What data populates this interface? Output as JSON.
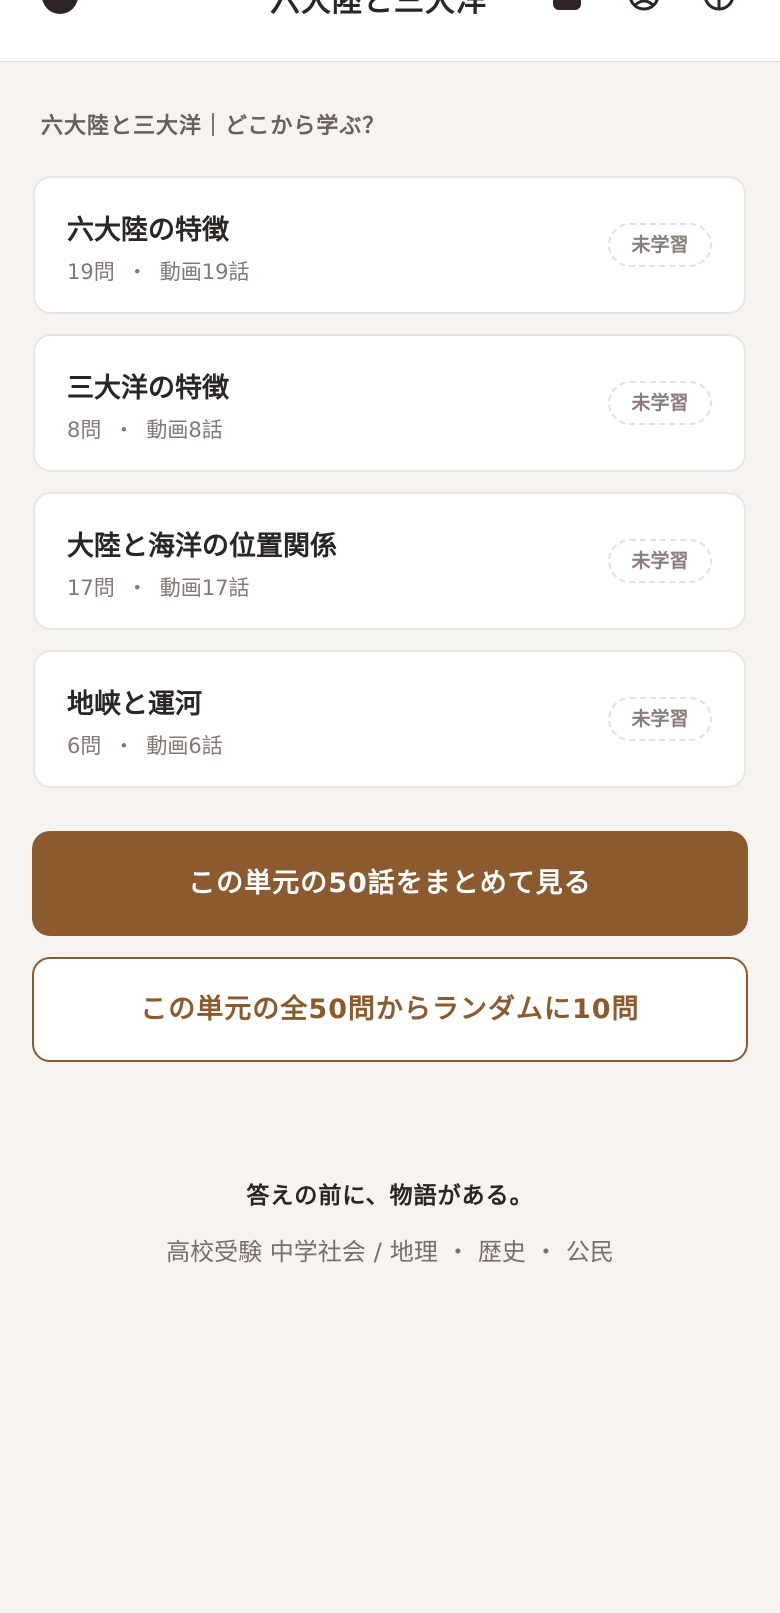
{
  "header": {
    "title": "六大陸と三大洋",
    "icons": [
      "back-icon",
      "book-icon",
      "user-icon",
      "help-icon"
    ]
  },
  "section": {
    "heading": "六大陸と三大洋｜どこから学ぶ？"
  },
  "topics": [
    {
      "title": "六大陸の特徴",
      "questions": "19問",
      "separator": "・",
      "videos": "動画19話",
      "status": "未学習"
    },
    {
      "title": "三大洋の特徴",
      "questions": "8問",
      "separator": "・",
      "videos": "動画8話",
      "status": "未学習"
    },
    {
      "title": "大陸と海洋の位置関係",
      "questions": "17問",
      "separator": "・",
      "videos": "動画17話",
      "status": "未学習"
    },
    {
      "title": "地峡と運河",
      "questions": "6問",
      "separator": "・",
      "videos": "動画6話",
      "status": "未学習"
    }
  ],
  "actions": {
    "watch_all_label": "この単元の50話をまとめて見る",
    "random_quiz_label": "この単元の全50問からランダムに10問"
  },
  "footer": {
    "tagline": "答えの前に、物語がある。",
    "site_label": "高校受験 中学社会",
    "slash": "/",
    "subjects": [
      "地理",
      "歴史",
      "公民"
    ],
    "subject_separator": "・"
  },
  "colors": {
    "accent": "#8b5a2e",
    "background": "#f7f3f0",
    "card": "#ffffff",
    "text": "#2b2523",
    "muted": "#847874"
  }
}
